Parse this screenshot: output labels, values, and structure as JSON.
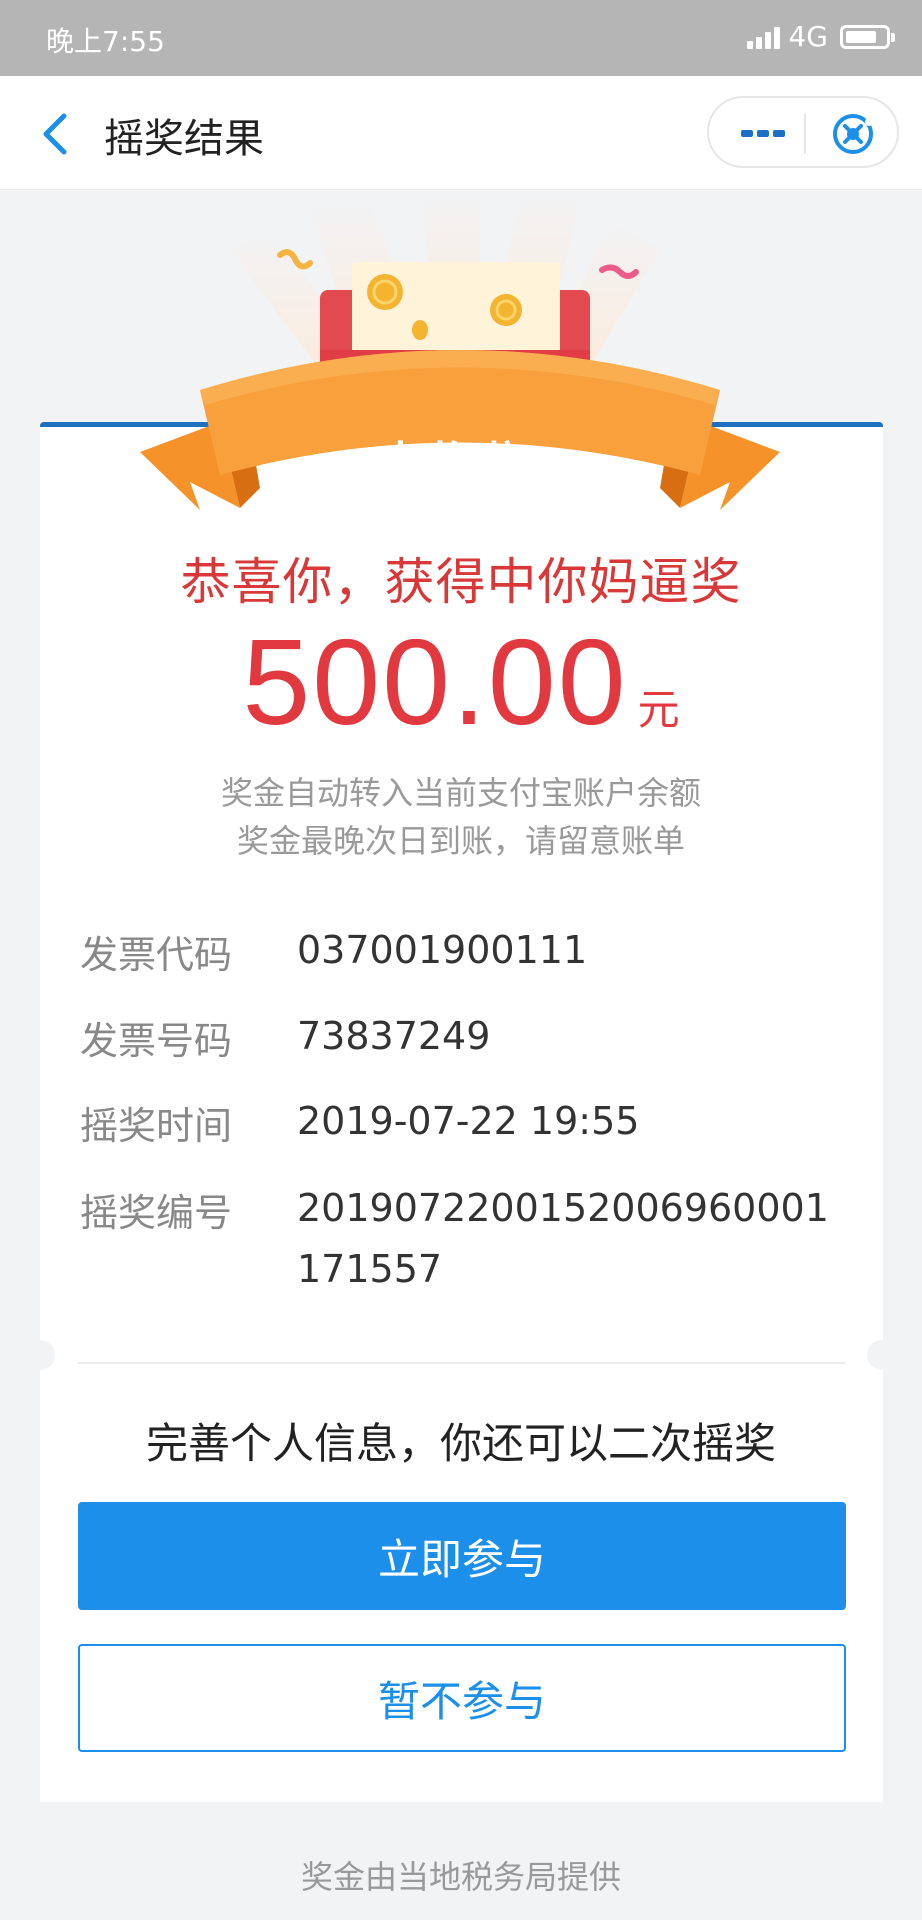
{
  "status_bar": {
    "time": "晚上7:55",
    "network": "4G"
  },
  "nav": {
    "title": "摇奖结果",
    "back_icon": "chevron-left-icon",
    "more_icon": "more-dots-icon",
    "close_icon": "close-circle-icon"
  },
  "banner": {
    "ribbon_text": "中奖啦!"
  },
  "result": {
    "congrats": "恭喜你，获得中你妈逼奖",
    "amount": "500.00",
    "unit": "元",
    "note_line1": "奖金自动转入当前支付宝账户余额",
    "note_line2": "奖金最晚次日到账，请留意账单"
  },
  "info": [
    {
      "label": "发票代码",
      "value": "037001900111"
    },
    {
      "label": "发票号码",
      "value": "73837249"
    },
    {
      "label": "摇奖时间",
      "value": "2019-07-22 19:55"
    },
    {
      "label": "摇奖编号",
      "value": "2019072200152006960001171557"
    }
  ],
  "second_draw": {
    "prompt": "完善个人信息，你还可以二次摇奖",
    "join_label": "立即参与",
    "skip_label": "暂不参与"
  },
  "footer": {
    "text": "奖金由当地税务局提供"
  },
  "colors": {
    "accent_blue": "#1b8fea",
    "prize_red": "#e23940",
    "ribbon_orange": "#f5922a"
  }
}
